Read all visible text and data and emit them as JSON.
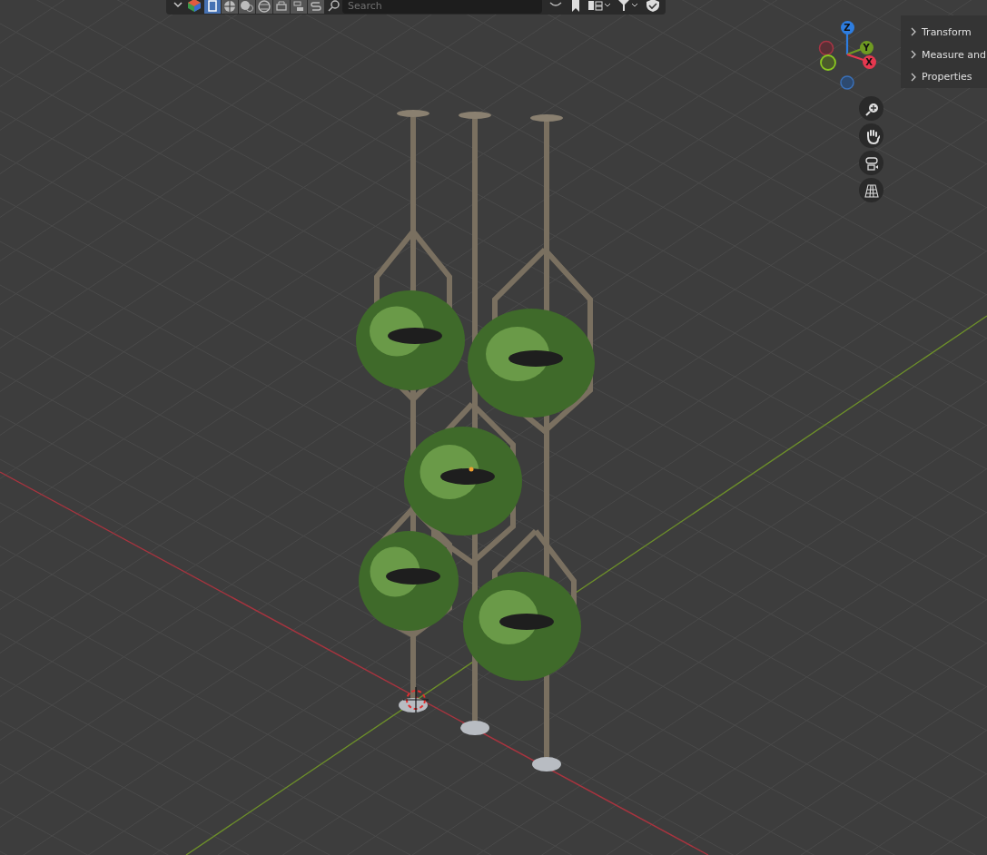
{
  "header": {
    "mode_buttons": [
      {
        "selected": true
      },
      {
        "selected": false
      },
      {
        "selected": false
      },
      {
        "selected": false
      },
      {
        "selected": false
      },
      {
        "selected": false
      },
      {
        "selected": false
      }
    ],
    "search": {
      "placeholder": "Search"
    }
  },
  "gizmo": {
    "axes": [
      {
        "label": "Z",
        "color": "#2d7de0"
      },
      {
        "label": "Y",
        "color": "#6f9a22"
      },
      {
        "label": "X",
        "color": "#e5384f"
      }
    ]
  },
  "sidebar": {
    "panels": [
      {
        "label": "Transform",
        "expanded": false
      },
      {
        "label": "Measure and",
        "expanded": false
      },
      {
        "label": "Properties",
        "expanded": false
      }
    ]
  }
}
